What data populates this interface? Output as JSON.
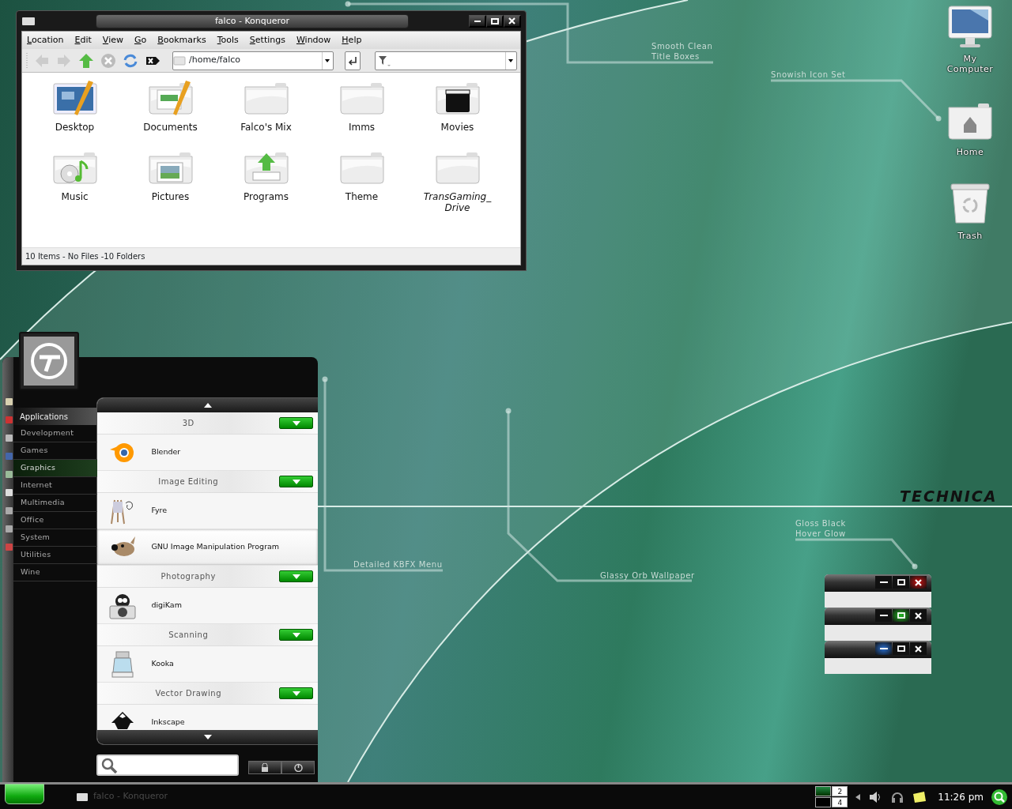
{
  "konqueror": {
    "title": "falco - Konqueror",
    "menu": [
      "Location",
      "Edit",
      "View",
      "Go",
      "Bookmarks",
      "Tools",
      "Settings",
      "Window",
      "Help"
    ],
    "location": "/home/falco",
    "items": [
      {
        "label": "Desktop",
        "kind": "desktop",
        "symlink": false
      },
      {
        "label": "Documents",
        "kind": "documents",
        "symlink": false
      },
      {
        "label": "Falco's Mix",
        "kind": "folder",
        "symlink": false
      },
      {
        "label": "Imms",
        "kind": "folder",
        "symlink": false
      },
      {
        "label": "Movies",
        "kind": "movies",
        "symlink": false
      },
      {
        "label": "Music",
        "kind": "music",
        "symlink": false
      },
      {
        "label": "Pictures",
        "kind": "pictures",
        "symlink": false
      },
      {
        "label": "Programs",
        "kind": "programs",
        "symlink": false
      },
      {
        "label": "Theme",
        "kind": "folder",
        "symlink": false
      },
      {
        "label": "TransGaming_ Drive",
        "kind": "folder",
        "symlink": true
      }
    ],
    "status": "10 Items - No Files -10 Folders"
  },
  "desktop_icons": [
    {
      "label": "My Computer",
      "kind": "computer"
    },
    {
      "label": "Home",
      "kind": "home"
    },
    {
      "label": "Trash",
      "kind": "trash"
    }
  ],
  "annotations": [
    {
      "lines": [
        "Smooth Clean",
        "Title Boxes"
      ]
    },
    {
      "lines": [
        "Snowish Icon Set"
      ]
    },
    {
      "lines": [
        "Detailed KBFX Menu"
      ]
    },
    {
      "lines": [
        "Glassy Orb Wallpaper"
      ]
    },
    {
      "lines": [
        "Gloss Black",
        "Hover Glow"
      ]
    }
  ],
  "logo": "TECHNICA",
  "kbfx": {
    "header": "Applications",
    "categories": [
      {
        "label": "Development",
        "selected": false
      },
      {
        "label": "Games",
        "selected": false
      },
      {
        "label": "Graphics",
        "selected": true
      },
      {
        "label": "Internet",
        "selected": false
      },
      {
        "label": "Multimedia",
        "selected": false
      },
      {
        "label": "Office",
        "selected": false
      },
      {
        "label": "System",
        "selected": false
      },
      {
        "label": "Utilities",
        "selected": false
      },
      {
        "label": "Wine",
        "selected": false
      }
    ],
    "groups": [
      {
        "title": "3D",
        "apps": [
          {
            "name": "Blender",
            "kind": "blender",
            "hovered": false
          }
        ]
      },
      {
        "title": "Image Editing",
        "apps": [
          {
            "name": "Fyre",
            "kind": "fyre",
            "hovered": false
          },
          {
            "name": "GNU Image Manipulation Program",
            "kind": "gimp",
            "hovered": true
          }
        ]
      },
      {
        "title": "Photography",
        "apps": [
          {
            "name": "digiKam",
            "kind": "digikam",
            "hovered": false
          }
        ]
      },
      {
        "title": "Scanning",
        "apps": [
          {
            "name": "Kooka",
            "kind": "kooka",
            "hovered": false
          }
        ]
      },
      {
        "title": "Vector Drawing",
        "apps": [
          {
            "name": "Inkscape",
            "kind": "inkscape",
            "hovered": false
          }
        ]
      }
    ]
  },
  "button_demo": [
    {
      "minimize_glow": false,
      "maximize_glow": false,
      "close_glow": true
    },
    {
      "minimize_glow": false,
      "maximize_glow": true,
      "close_glow": false
    },
    {
      "minimize_glow": true,
      "maximize_glow": false,
      "close_glow": false
    }
  ],
  "taskbar": {
    "tasks": [
      {
        "title": "falco - Konqueror"
      }
    ],
    "pager": [
      {
        "selected": true
      },
      {
        "label": "2",
        "selected": false
      },
      {
        "selected": false
      },
      {
        "label": "4",
        "selected": false
      }
    ],
    "clock": "11:26 pm"
  }
}
